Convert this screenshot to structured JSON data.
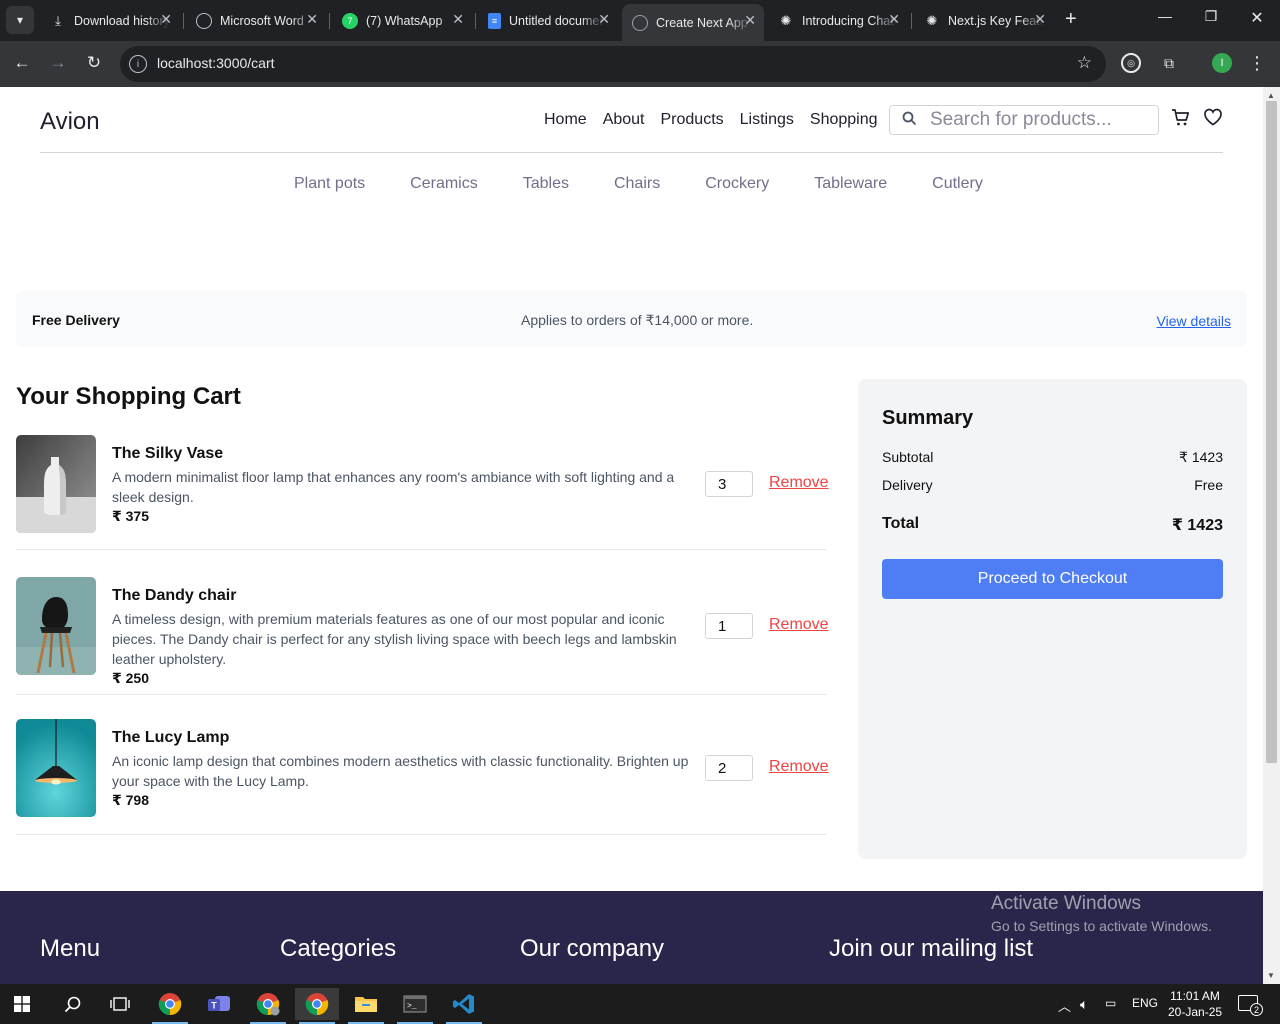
{
  "browser": {
    "tabs": [
      {
        "label": "Download history",
        "active": false
      },
      {
        "label": "Microsoft Word",
        "active": false
      },
      {
        "label": "(7) WhatsApp",
        "active": false
      },
      {
        "label": "Untitled document",
        "active": false
      },
      {
        "label": "Create Next App",
        "active": true
      },
      {
        "label": "Introducing ChatGPT",
        "active": false
      },
      {
        "label": "Next.js Key Features",
        "active": false
      }
    ],
    "url": "localhost:3000/cart",
    "profile_initial": "I"
  },
  "site": {
    "brand": "Avion",
    "nav": [
      "Home",
      "About",
      "Products",
      "Listings",
      "Shopping"
    ],
    "search_placeholder": "Search for products...",
    "categories": [
      "Plant pots",
      "Ceramics",
      "Tables",
      "Chairs",
      "Crockery",
      "Tableware",
      "Cutlery"
    ]
  },
  "banner": {
    "title": "Free Delivery",
    "text": "Applies to orders of ₹14,000 or more.",
    "link": "View details"
  },
  "cart": {
    "title": "Your Shopping Cart",
    "remove_label": "Remove",
    "items": [
      {
        "name": "The Silky Vase",
        "description": "A modern minimalist floor lamp that enhances any room's ambiance with soft lighting and a sleek design.",
        "price": "₹ 375",
        "quantity": "3"
      },
      {
        "name": "The Dandy chair",
        "description": "A timeless design, with premium materials features as one of our most popular and iconic pieces. The Dandy chair is perfect for any stylish living space with beech legs and lambskin leather upholstery.",
        "price": "₹ 250",
        "quantity": "1"
      },
      {
        "name": "The Lucy Lamp",
        "description": "An iconic lamp design that combines modern aesthetics with classic functionality. Brighten up your space with the Lucy Lamp.",
        "price": "₹ 798",
        "quantity": "2"
      }
    ]
  },
  "summary": {
    "title": "Summary",
    "subtotal_label": "Subtotal",
    "subtotal_value": "₹ 1423",
    "delivery_label": "Delivery",
    "delivery_value": "Free",
    "total_label": "Total",
    "total_value": "₹ 1423",
    "checkout_label": "Proceed to Checkout"
  },
  "footer": {
    "headings": [
      "Menu",
      "Categories",
      "Our company",
      "Join our mailing list"
    ]
  },
  "watermark": {
    "line1": "Activate Windows",
    "line2": "Go to Settings to activate Windows."
  },
  "taskbar": {
    "language": "ENG",
    "time": "11:01 AM",
    "date": "20-Jan-25",
    "notification_count": "2"
  },
  "colors": {
    "accent": "#4f7df3",
    "footer_bg": "#2a254b",
    "remove": "#ef4444",
    "link": "#2563eb"
  }
}
